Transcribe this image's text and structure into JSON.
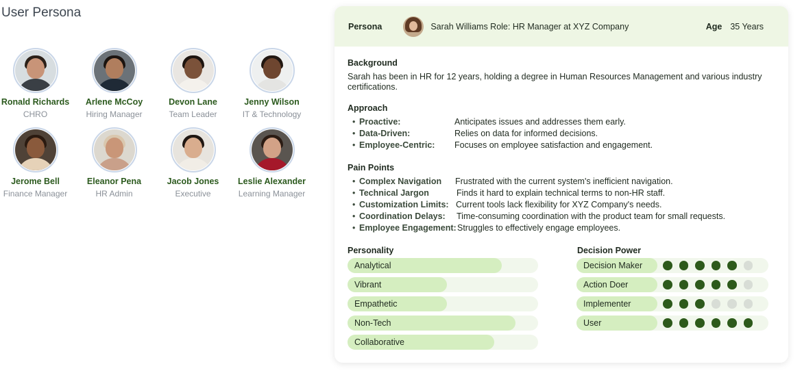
{
  "page_title": "User Persona",
  "people": [
    {
      "name": "Ronald Richards",
      "role": "CHRO"
    },
    {
      "name": "Arlene McCoy",
      "role": "Hiring Manager"
    },
    {
      "name": "Devon Lane",
      "role": "Team Leader"
    },
    {
      "name": "Jenny Wilson",
      "role": "IT & Technology"
    },
    {
      "name": "Jerome Bell",
      "role": "Finance Manager"
    },
    {
      "name": "Eleanor Pena",
      "role": "HR Admin"
    },
    {
      "name": "Jacob Jones",
      "role": "Executive"
    },
    {
      "name": "Leslie Alexander",
      "role": "Learning Manager"
    }
  ],
  "persona": {
    "label": "Persona",
    "summary": "Sarah Williams Role: HR Manager at XYZ Company",
    "age_label": "Age",
    "age_value": "35 Years"
  },
  "background": {
    "title": "Background",
    "text": "Sarah has been in HR for 12 years, holding a degree in Human Resources Management and various industry certifications."
  },
  "approach": {
    "title": "Approach",
    "items": [
      {
        "key": "Proactive:",
        "value": "Anticipates issues and addresses them early."
      },
      {
        "key": "Data-Driven:",
        "value": "Relies on data for informed decisions."
      },
      {
        "key": "Employee-Centric:",
        "value": "Focuses on employee satisfaction and engagement."
      }
    ]
  },
  "pain_points": {
    "title": "Pain Points",
    "items": [
      {
        "key": "Complex Navigation",
        "value": "Frustrated with the current system's inefficient navigation."
      },
      {
        "key": "Technical Jargon",
        "value": "Finds it hard to explain technical terms to non-HR staff."
      },
      {
        "key": "Customization Limits:",
        "value": "Current tools lack flexibility for XYZ Company's needs."
      },
      {
        "key": "Coordination Delays:",
        "value": "Time-consuming coordination with the product team for small requests."
      },
      {
        "key": "Employee Engagement:",
        "value": "Struggles to effectively engage employees."
      }
    ]
  },
  "personality": {
    "title": "Personality",
    "traits": [
      {
        "label": "Analytical",
        "level": 0.81
      },
      {
        "label": "Vibrant",
        "level": 0.52
      },
      {
        "label": "Empathetic",
        "level": 0.52
      },
      {
        "label": "Non-Tech",
        "level": 0.88
      },
      {
        "label": "Collaborative",
        "level": 0.77
      }
    ]
  },
  "decision_power": {
    "title": "Decision Power",
    "max": 6,
    "roles": [
      {
        "label": "Decision Maker",
        "score": 5
      },
      {
        "label": "Action Doer",
        "score": 5
      },
      {
        "label": "Implementer",
        "score": 3
      },
      {
        "label": "User",
        "score": 6
      }
    ]
  },
  "colors": {
    "accent_dark": "#2d5a1b",
    "accent_light": "#d5eec0",
    "header_bg": "#eef6e4",
    "name_green": "#2c5a1e"
  }
}
